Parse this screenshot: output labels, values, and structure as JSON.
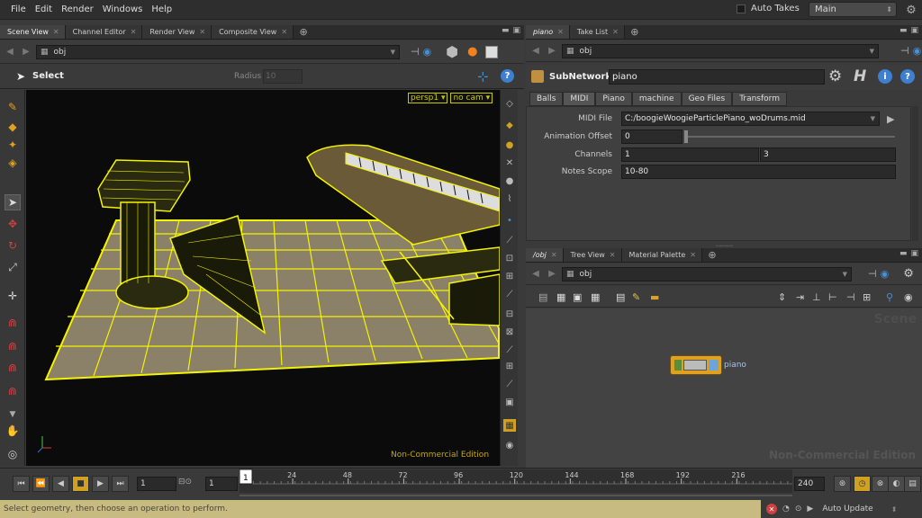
{
  "menu": [
    "File",
    "Edit",
    "Render",
    "Windows",
    "Help"
  ],
  "top_right": {
    "auto_takes": "Auto Takes",
    "desktop": "Main"
  },
  "left_tabs": [
    "Scene View",
    "Channel Editor",
    "Render View",
    "Composite View"
  ],
  "left_path": "obj",
  "tool": {
    "name": "Select",
    "radius_label": "Radius",
    "radius_value": "10"
  },
  "viewport": {
    "camera_menu": "persp1",
    "cam_menu": "no cam",
    "watermark": "Non-Commercial Edition"
  },
  "param_tabs_header": [
    "piano",
    "Take List"
  ],
  "param_path": "obj",
  "node": {
    "type": "SubNetwork",
    "name": "piano"
  },
  "param_tabs": [
    "Balls",
    "MIDI",
    "Piano",
    "machine",
    "Geo Files",
    "Transform"
  ],
  "params": {
    "midi_file_label": "MIDI File",
    "midi_file_value": "C:/boogieWoogieParticlePiano_woDrums.mid",
    "anim_offset_label": "Animation Offset",
    "anim_offset_value": "0",
    "channels_label": "Channels",
    "channels_value_1": "1",
    "channels_value_2": "3",
    "notes_scope_label": "Notes Scope",
    "notes_scope_value": "10-80"
  },
  "network_tabs": [
    "/obj",
    "Tree View",
    "Material Palette"
  ],
  "network_path": "obj",
  "network": {
    "scene_label": "Scene",
    "node_name": "piano",
    "watermark": "Non-Commercial Edition"
  },
  "timeline": {
    "current_frame": "1",
    "start_frame": "1",
    "end_frame": "240",
    "frame_marker": "1",
    "ticks": [
      "24",
      "48",
      "72",
      "96",
      "120",
      "144",
      "168",
      "192",
      "216"
    ]
  },
  "status": {
    "message": "Select geometry, then choose an operation to perform.",
    "update_mode": "Auto Update"
  },
  "colors": {
    "wireframe": "#f4f400",
    "floor": "#8b8068",
    "status_bg": "#c7bb82",
    "node_accent": "#e0a020"
  }
}
